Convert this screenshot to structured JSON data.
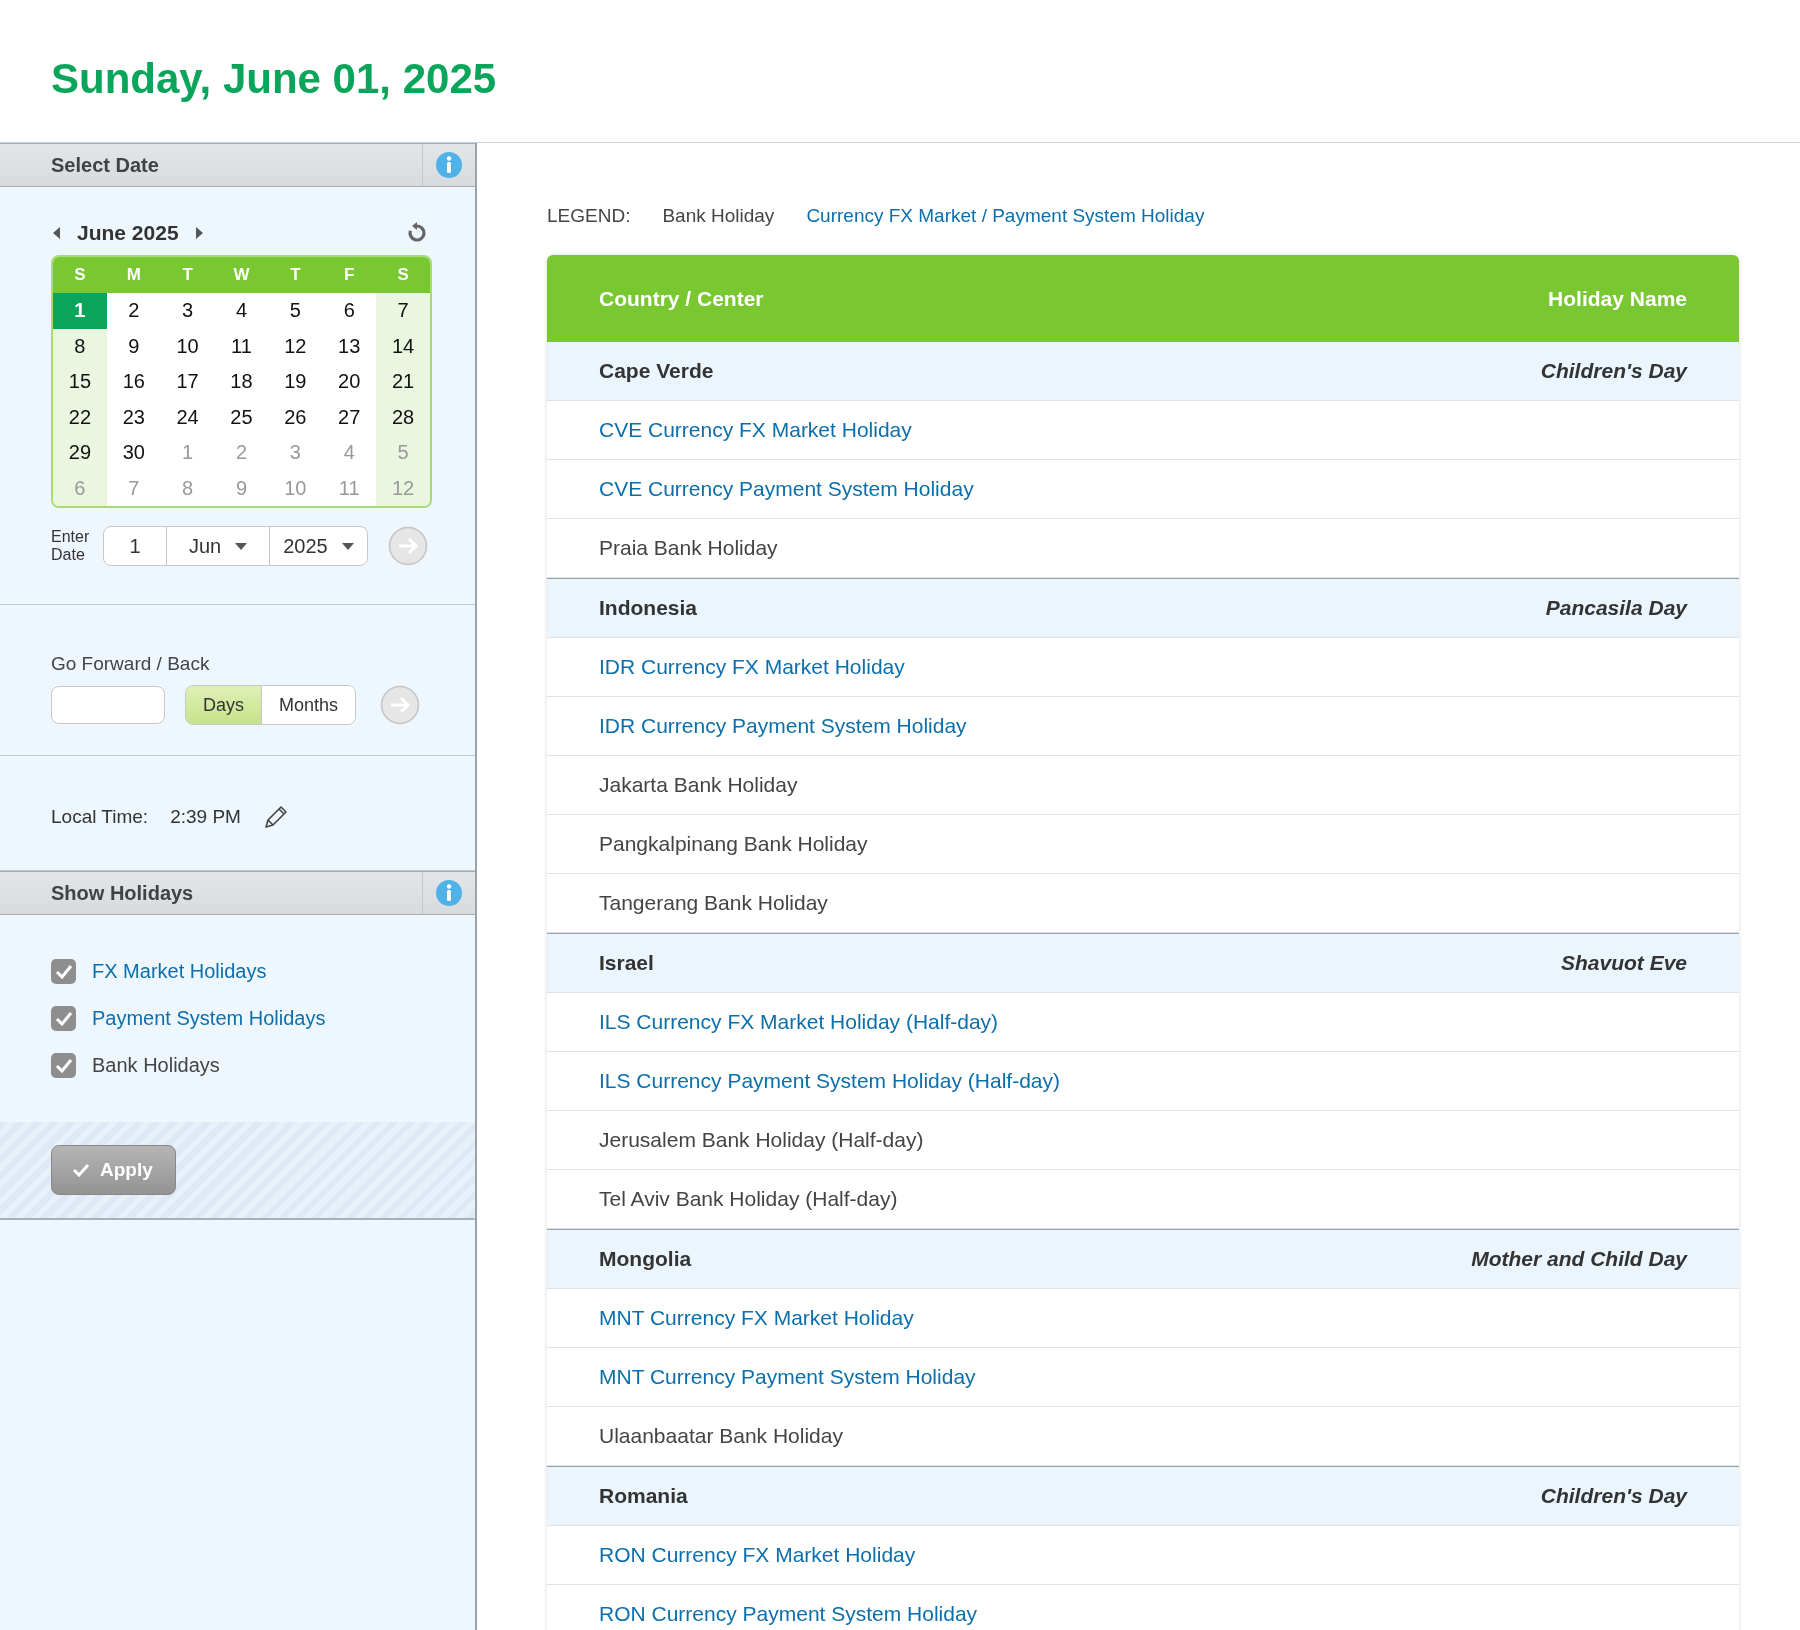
{
  "page_title": "Sunday, June 01, 2025",
  "sidebar": {
    "select_date": {
      "title": "Select Date",
      "month_label": "June 2025",
      "weekdays": [
        "S",
        "M",
        "T",
        "W",
        "T",
        "F",
        "S"
      ],
      "weeks": [
        [
          {
            "day": "1",
            "current": true,
            "selected": true
          },
          {
            "day": "2",
            "current": true,
            "selected": false
          },
          {
            "day": "3",
            "current": true,
            "selected": false
          },
          {
            "day": "4",
            "current": true,
            "selected": false
          },
          {
            "day": "5",
            "current": true,
            "selected": false
          },
          {
            "day": "6",
            "current": true,
            "selected": false
          },
          {
            "day": "7",
            "current": true,
            "selected": false
          }
        ],
        [
          {
            "day": "8",
            "current": true,
            "selected": false
          },
          {
            "day": "9",
            "current": true,
            "selected": false
          },
          {
            "day": "10",
            "current": true,
            "selected": false
          },
          {
            "day": "11",
            "current": true,
            "selected": false
          },
          {
            "day": "12",
            "current": true,
            "selected": false
          },
          {
            "day": "13",
            "current": true,
            "selected": false
          },
          {
            "day": "14",
            "current": true,
            "selected": false
          }
        ],
        [
          {
            "day": "15",
            "current": true,
            "selected": false
          },
          {
            "day": "16",
            "current": true,
            "selected": false
          },
          {
            "day": "17",
            "current": true,
            "selected": false
          },
          {
            "day": "18",
            "current": true,
            "selected": false
          },
          {
            "day": "19",
            "current": true,
            "selected": false
          },
          {
            "day": "20",
            "current": true,
            "selected": false
          },
          {
            "day": "21",
            "current": true,
            "selected": false
          }
        ],
        [
          {
            "day": "22",
            "current": true,
            "selected": false
          },
          {
            "day": "23",
            "current": true,
            "selected": false
          },
          {
            "day": "24",
            "current": true,
            "selected": false
          },
          {
            "day": "25",
            "current": true,
            "selected": false
          },
          {
            "day": "26",
            "current": true,
            "selected": false
          },
          {
            "day": "27",
            "current": true,
            "selected": false
          },
          {
            "day": "28",
            "current": true,
            "selected": false
          }
        ],
        [
          {
            "day": "29",
            "current": true,
            "selected": false
          },
          {
            "day": "30",
            "current": true,
            "selected": false
          },
          {
            "day": "1",
            "current": false,
            "selected": false
          },
          {
            "day": "2",
            "current": false,
            "selected": false
          },
          {
            "day": "3",
            "current": false,
            "selected": false
          },
          {
            "day": "4",
            "current": false,
            "selected": false
          },
          {
            "day": "5",
            "current": false,
            "selected": false
          }
        ],
        [
          {
            "day": "6",
            "current": false,
            "selected": false
          },
          {
            "day": "7",
            "current": false,
            "selected": false
          },
          {
            "day": "8",
            "current": false,
            "selected": false
          },
          {
            "day": "9",
            "current": false,
            "selected": false
          },
          {
            "day": "10",
            "current": false,
            "selected": false
          },
          {
            "day": "11",
            "current": false,
            "selected": false
          },
          {
            "day": "12",
            "current": false,
            "selected": false
          }
        ]
      ],
      "enter_date_label": "Enter Date",
      "day_value": "1",
      "month_value": "Jun",
      "year_value": "2025"
    },
    "go_forward": {
      "label": "Go Forward / Back",
      "units": [
        {
          "label": "Days",
          "selected": true
        },
        {
          "label": "Months",
          "selected": false
        }
      ]
    },
    "local_time": {
      "label": "Local Time:",
      "value": "2:39 PM"
    },
    "show_holidays": {
      "title": "Show Holidays",
      "options": [
        {
          "label": "FX Market Holidays",
          "kind": "currency",
          "checked": true
        },
        {
          "label": "Payment System Holidays",
          "kind": "currency",
          "checked": true
        },
        {
          "label": "Bank Holidays",
          "kind": "bank",
          "checked": true
        }
      ],
      "apply_button": "Apply"
    }
  },
  "legend": {
    "label": "LEGEND:",
    "items": [
      {
        "label": "Bank Holiday",
        "kind": "bank"
      },
      {
        "label": "Currency FX Market / Payment System Holiday",
        "kind": "currency"
      }
    ]
  },
  "table": {
    "columns": [
      "Country / Center",
      "Holiday Name"
    ],
    "groups": [
      {
        "country": "Cape Verde",
        "holiday": "Children's Day",
        "rows": [
          {
            "name": "CVE Currency FX Market Holiday",
            "kind": "currency"
          },
          {
            "name": "CVE Currency Payment System Holiday",
            "kind": "currency"
          },
          {
            "name": "Praia Bank Holiday",
            "kind": "bank"
          }
        ]
      },
      {
        "country": "Indonesia",
        "holiday": "Pancasila Day",
        "rows": [
          {
            "name": "IDR Currency FX Market Holiday",
            "kind": "currency"
          },
          {
            "name": "IDR Currency Payment System Holiday",
            "kind": "currency"
          },
          {
            "name": "Jakarta Bank Holiday",
            "kind": "bank"
          },
          {
            "name": "Pangkalpinang Bank Holiday",
            "kind": "bank"
          },
          {
            "name": "Tangerang Bank Holiday",
            "kind": "bank"
          }
        ]
      },
      {
        "country": "Israel",
        "holiday": "Shavuot Eve",
        "rows": [
          {
            "name": "ILS Currency FX Market Holiday (Half-day)",
            "kind": "currency"
          },
          {
            "name": "ILS Currency Payment System Holiday (Half-day)",
            "kind": "currency"
          },
          {
            "name": "Jerusalem Bank Holiday (Half-day)",
            "kind": "bank"
          },
          {
            "name": "Tel Aviv Bank Holiday (Half-day)",
            "kind": "bank"
          }
        ]
      },
      {
        "country": "Mongolia",
        "holiday": "Mother and Child Day",
        "rows": [
          {
            "name": "MNT Currency FX Market Holiday",
            "kind": "currency"
          },
          {
            "name": "MNT Currency Payment System Holiday",
            "kind": "currency"
          },
          {
            "name": "Ulaanbaatar Bank Holiday",
            "kind": "bank"
          }
        ]
      },
      {
        "country": "Romania",
        "holiday": "Children's Day",
        "rows": [
          {
            "name": "RON Currency FX Market Holiday",
            "kind": "currency"
          },
          {
            "name": "RON Currency Payment System Holiday",
            "kind": "currency"
          }
        ]
      }
    ]
  }
}
